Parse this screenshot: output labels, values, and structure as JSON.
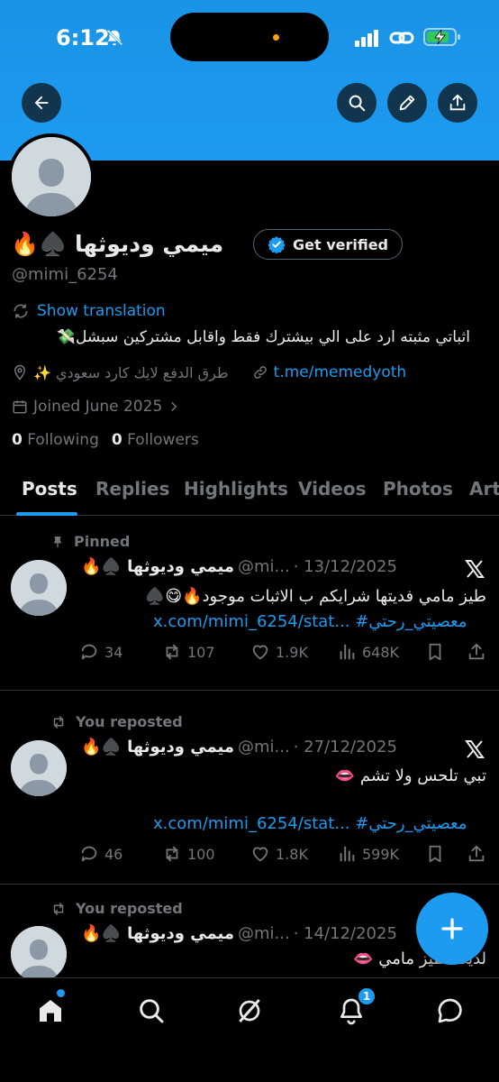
{
  "status_bar": {
    "time": "6:12"
  },
  "profile": {
    "display_name": "ميمي وديوثها ♠️🔥",
    "get_verified": "Get verified",
    "handle": "@mimi_6254",
    "show_translation": "Show translation",
    "bio": "اثباتي مثبته ارد على الي بيشترك فقط واقابل مشتركين سبشل💸",
    "location": "طرق الدفع لايك كارد سعودي ✨",
    "website": "t.me/memedyoth",
    "joined": "Joined June 2025",
    "following_count": "0",
    "following_label": "Following",
    "followers_count": "0",
    "followers_label": "Followers"
  },
  "tabs": [
    {
      "label": "Posts"
    },
    {
      "label": "Replies"
    },
    {
      "label": "Highlights"
    },
    {
      "label": "Videos"
    },
    {
      "label": "Photos"
    },
    {
      "label": "Art"
    }
  ],
  "posts": [
    {
      "context": "Pinned",
      "name": "ميمي وديوثها ♠️🔥",
      "handle": "@mi...",
      "date": "· 13/12/2025",
      "text": "طيز مامي فديتها شرايكم ب الاثبات موجود🔥😋♠️",
      "link": "x.com/mimi_6254/stat... #معصيتي_رحتي",
      "replies": "34",
      "reposts": "107",
      "likes": "1.9K",
      "views": "648K"
    },
    {
      "context": "You reposted",
      "name": "ميمي وديوثها ♠️🔥",
      "handle": "@mi...",
      "date": "· 27/12/2025",
      "text": "تبي تلحس ولا تشم 👄",
      "link": "x.com/mimi_6254/stat... #معصيتي_رحتي",
      "replies": "46",
      "reposts": "100",
      "likes": "1.8K",
      "views": "599K"
    },
    {
      "context": "You reposted",
      "name": "ميمي وديوثها ♠️🔥",
      "handle": "@mi...",
      "date": "· 14/12/2025",
      "text": "لذيذه طيز مامي 👄"
    }
  ],
  "notifications_badge": "1",
  "colors": {
    "accent": "#1d9bf0",
    "background": "#000000",
    "muted": "#71767b"
  }
}
